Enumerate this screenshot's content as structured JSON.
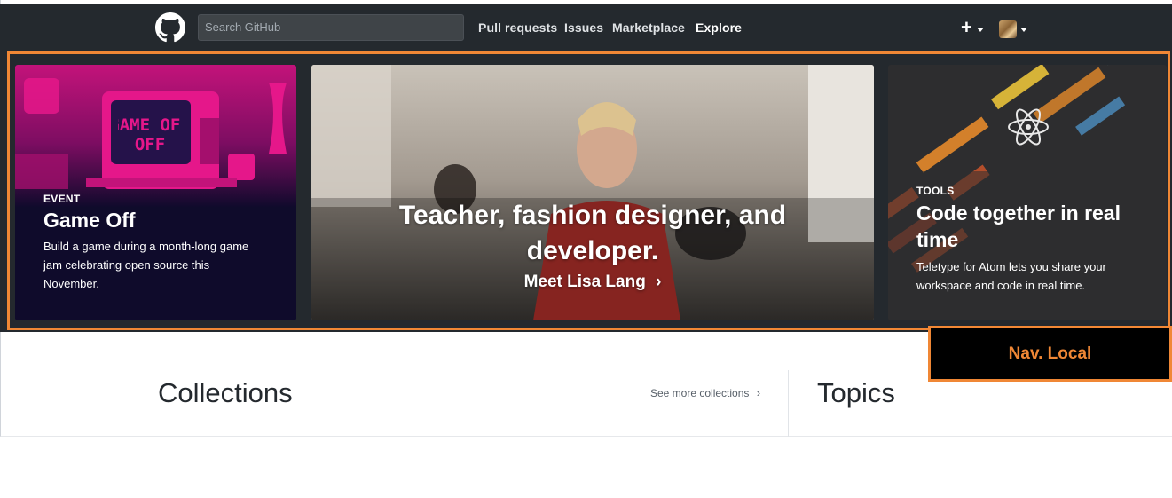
{
  "header": {
    "search_placeholder": "Search GitHub",
    "nav": [
      {
        "label": "Pull requests"
      },
      {
        "label": "Issues"
      },
      {
        "label": "Marketplace"
      },
      {
        "label": "Explore"
      }
    ],
    "plus_label": "+"
  },
  "hero": {
    "left": {
      "eyebrow": "EVENT",
      "title": "Game Off",
      "desc_lines": [
        "Build a game during a month-long game",
        "jam celebrating open source this",
        "November."
      ],
      "art_label": "GAME OFF"
    },
    "middle": {
      "title_lines": [
        "Teacher, fashion designer, and",
        "developer."
      ],
      "link": "Meet Lisa Lang"
    },
    "right": {
      "eyebrow": "TOOLS",
      "title_lines": [
        "Code together in real",
        "time"
      ],
      "desc_lines": [
        "Teletype for Atom lets you share your",
        "workspace and code in real time."
      ]
    }
  },
  "annotation": {
    "label": "Nav. Local",
    "color": "#f08735"
  },
  "sections": {
    "collections_title": "Collections",
    "see_more": "See more collections",
    "topics_title": "Topics"
  },
  "icons": [
    "github-logo-icon",
    "plus-icon",
    "chevron-down-icon",
    "chevron-right-icon",
    "atom-icon"
  ],
  "colors": {
    "header_bg": "#24292e",
    "annotation_orange": "#f08735",
    "game_off_pink": "#e5178a"
  }
}
